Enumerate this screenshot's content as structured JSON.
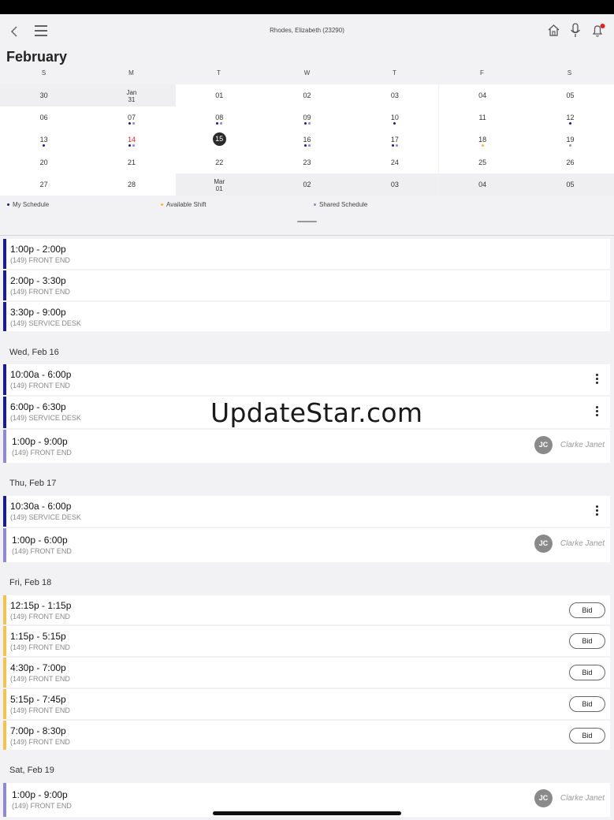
{
  "header": {
    "title": "Rhodes, Elizabeth (23290)",
    "icons": [
      "back-icon",
      "menu-icon",
      "home-icon",
      "microphone-icon",
      "bell-icon"
    ]
  },
  "calendar": {
    "month": "February",
    "weekdays": [
      "S",
      "M",
      "T",
      "W",
      "T",
      "F",
      "S"
    ],
    "rows": [
      [
        {
          "t": "30"
        },
        {
          "t": "Jan",
          "t2": "31"
        },
        {
          "t": "01"
        },
        {
          "t": "02"
        },
        {
          "t": "03"
        },
        {
          "t": "04"
        },
        {
          "t": "05"
        }
      ],
      [
        {
          "t": "06"
        },
        {
          "t": "07"
        },
        {
          "t": "08"
        },
        {
          "t": "09"
        },
        {
          "t": "10"
        },
        {
          "t": "11"
        },
        {
          "t": "12"
        }
      ],
      [
        {
          "t": "13"
        },
        {
          "t": "14"
        },
        {
          "t": "15"
        },
        {
          "t": "16"
        },
        {
          "t": "17"
        },
        {
          "t": "18"
        },
        {
          "t": "19"
        }
      ],
      [
        {
          "t": "20"
        },
        {
          "t": "21"
        },
        {
          "t": "22"
        },
        {
          "t": "23"
        },
        {
          "t": "24"
        },
        {
          "t": "25"
        },
        {
          "t": "26"
        }
      ],
      [
        {
          "t": "27"
        },
        {
          "t": "28"
        },
        {
          "t": "Mar",
          "t2": "01"
        },
        {
          "t": "02"
        },
        {
          "t": "03"
        },
        {
          "t": "04"
        },
        {
          "t": "05"
        }
      ]
    ],
    "today": "15",
    "highlighted_red": "14"
  },
  "legend": {
    "my_schedule": "My Schedule",
    "available_shift": "Available Shift",
    "shared_schedule": "Shared Schedule"
  },
  "colors": {
    "my_schedule": "#1a1a9c",
    "available_shift": "#f4b63a",
    "shared_schedule": "#8a86d8"
  },
  "shifts": {
    "s1": {
      "time": "1:00p - 2:00p",
      "loc": "(149) FRONT END"
    },
    "s2": {
      "time": "2:00p - 3:30p",
      "loc": "(149) FRONT END"
    },
    "s3": {
      "time": "3:30p - 9:00p",
      "loc": "(149) SERVICE DESK"
    },
    "wed": "Wed, Feb 16",
    "s4": {
      "time": "10:00a - 6:00p",
      "loc": "(149) FRONT END"
    },
    "s5": {
      "time": "6:00p - 6:30p",
      "loc": "(149) SERVICE DESK"
    },
    "s6": {
      "time": "1:00p - 9:00p",
      "loc": "(149) FRONT END",
      "initials": "JC",
      "person": "Clarke Janet"
    },
    "thu": "Thu, Feb 17",
    "s7": {
      "time": "10:30a - 6:00p",
      "loc": "(149) SERVICE DESK"
    },
    "s8": {
      "time": "1:00p - 6:00p",
      "loc": "(149) FRONT END",
      "initials": "JC",
      "person": "Clarke Janet"
    },
    "fri": "Fri, Feb 18",
    "s9": {
      "time": "12:15p - 1:15p",
      "loc": "(149) FRONT END"
    },
    "s10": {
      "time": "1:15p - 5:15p",
      "loc": "(149) FRONT END"
    },
    "s11": {
      "time": "4:30p - 7:00p",
      "loc": "(149) FRONT END"
    },
    "s12": {
      "time": "5:15p - 7:45p",
      "loc": "(149) FRONT END"
    },
    "s13": {
      "time": "7:00p - 8:30p",
      "loc": "(149) FRONT END"
    },
    "sat": "Sat, Feb 19",
    "s14": {
      "time": "1:00p - 9:00p",
      "loc": "(149) FRONT END",
      "initials": "JC",
      "person": "Clarke Janet"
    },
    "bid_label": "Bid"
  },
  "watermark": "UpdateStar.com"
}
